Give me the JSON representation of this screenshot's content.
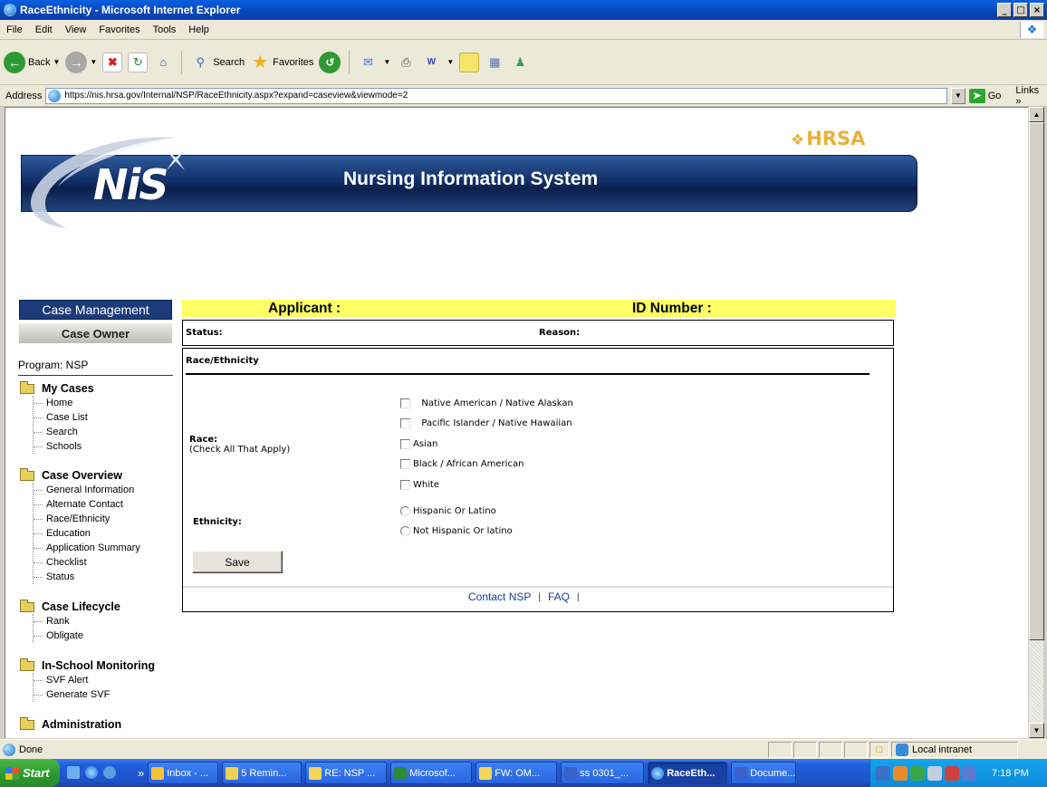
{
  "window": {
    "title": "RaceEthnicity - Microsoft Internet Explorer",
    "buttons": [
      "_",
      "□",
      "×"
    ]
  },
  "menu": [
    "File",
    "Edit",
    "View",
    "Favorites",
    "Tools",
    "Help"
  ],
  "toolbar": {
    "back_label": "Back",
    "search_label": "Search",
    "favorites_label": "Favorites"
  },
  "address": {
    "label": "Address",
    "url": "https://nis.hrsa.gov/Internal/NSP/RaceEthnicity.aspx?expand=caseview&viewmode=2",
    "go_label": "Go",
    "links_label": "Links"
  },
  "banner": {
    "hrsa_logo": "HRSA",
    "nis_logo": "NiS",
    "title": "Nursing Information System"
  },
  "sidebar": {
    "header": "Case Management",
    "owner": "Case Owner",
    "program": "Program: NSP",
    "sections": [
      {
        "title": "My Cases",
        "items": [
          "Home",
          "Case List",
          "Search",
          "Schools"
        ]
      },
      {
        "title": "Case Overview",
        "items": [
          "General Information",
          "Alternate Contact",
          "Race/Ethnicity",
          "Education",
          "Application Summary",
          "Checklist",
          "Status"
        ]
      },
      {
        "title": "Case Lifecycle",
        "items": [
          "Rank",
          "Obligate"
        ]
      },
      {
        "title": "In-School Monitoring",
        "items": [
          "SVF Alert",
          "Generate SVF"
        ]
      },
      {
        "title": "Administration",
        "items": []
      }
    ]
  },
  "main": {
    "applicant_label": "Applicant :",
    "id_label": "ID Number :",
    "status_label": "Status:",
    "reason_label": "Reason:",
    "form_title": "Race/Ethnicity",
    "race_label": "Race:",
    "race_hint": "(Check All That Apply)",
    "race_options": [
      "Native American / Native Alaskan",
      "Pacific Islander / Native Hawaiian",
      "Asian",
      "Black / African American",
      "White"
    ],
    "ethnicity_label": "Ethnicity:",
    "ethnicity_options": [
      "Hispanic Or Latino",
      "Not Hispanic Or latino"
    ],
    "save_label": "Save",
    "footer_links": [
      "Contact NSP",
      "FAQ"
    ],
    "footer_sep": "|"
  },
  "statusbar": {
    "text": "Done",
    "zone": "Local intranet"
  },
  "taskbar": {
    "start": "Start",
    "chevron": "»",
    "tasks": [
      "Inbox - ...",
      "5 Remin...",
      "RE: NSP ...",
      "Microsof...",
      "FW: OM...",
      "ss 0301_...",
      "RaceEth...",
      "Docume..."
    ],
    "time": "7:18 PM"
  }
}
